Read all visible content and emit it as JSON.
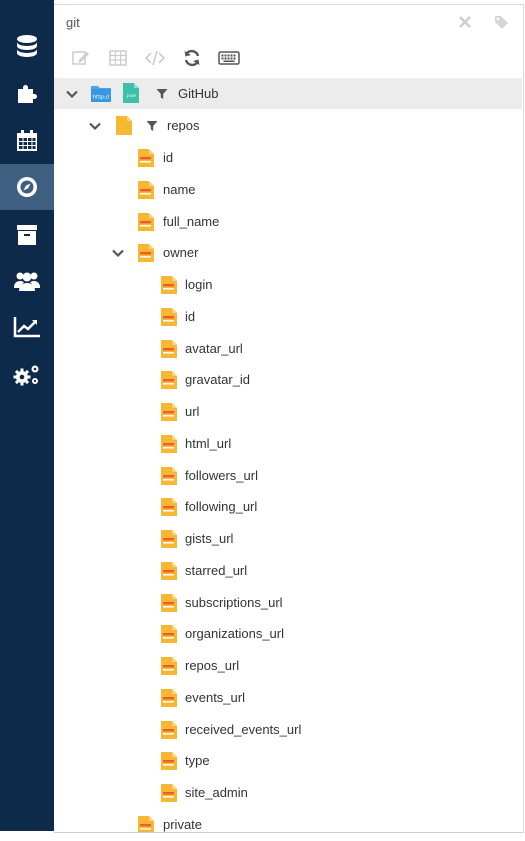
{
  "panel": {
    "title": "git"
  },
  "nav": {
    "items": [
      {
        "icon": "database-icon"
      },
      {
        "icon": "puzzle-icon"
      },
      {
        "icon": "calendar-icon"
      },
      {
        "icon": "compass-icon",
        "active": true
      },
      {
        "icon": "archive-icon"
      },
      {
        "icon": "users-icon"
      },
      {
        "icon": "chart-icon"
      },
      {
        "icon": "gears-icon"
      }
    ]
  },
  "toolbar": {
    "icons": [
      "edit-icon",
      "table-icon",
      "code-icon",
      "refresh-icon",
      "keyboard-icon"
    ]
  },
  "tree": {
    "root_label": "GitHub",
    "root_http_icon_text": "http://",
    "root_json_icon_text": ".json",
    "repos_label": "repos",
    "repos_fields": [
      "id",
      "name",
      "full_name"
    ],
    "owner_label": "owner",
    "owner_fields": [
      "login",
      "id",
      "avatar_url",
      "gravatar_id",
      "url",
      "html_url",
      "followers_url",
      "following_url",
      "gists_url",
      "starred_url",
      "subscriptions_url",
      "organizations_url",
      "repos_url",
      "events_url",
      "received_events_url",
      "type",
      "site_admin"
    ],
    "after_owner_fields": [
      "private"
    ]
  },
  "colors": {
    "nav_bg": "#0d2a4a",
    "nav_active": "#3f5f80",
    "field_icon": "#f7b733",
    "field_icon_stripe": "#ef5a2f",
    "folder_icon": "#f7b733"
  }
}
